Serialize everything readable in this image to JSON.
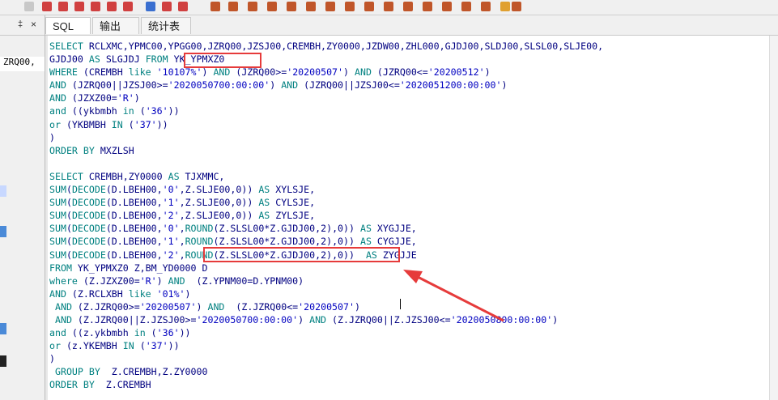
{
  "left_panel": {
    "pin_glyph": "‡",
    "close_glyph": "×",
    "entry_text": "ZRQ00,"
  },
  "tabs": [
    {
      "label": "SQL"
    },
    {
      "label": "输出"
    },
    {
      "label": "统计表"
    }
  ],
  "code_lines": [
    [
      {
        "t": "SELECT",
        "c": "kw"
      },
      {
        "t": " RCLXMC,YPMC00,YPGG00,JZRQ00,JZSJ00,CREMBH,ZY0000,JZDW00,ZHL000,GJDJ00,SLDJ00,SLSL00,SLJE00,"
      }
    ],
    [
      {
        "t": "GJDJ00 "
      },
      {
        "t": "AS",
        "c": "kw"
      },
      {
        "t": " SLGJDJ "
      },
      {
        "t": "FROM",
        "c": "kw"
      },
      {
        "t": " YK_YPMXZ0"
      }
    ],
    [
      {
        "t": "WHERE",
        "c": "kw"
      },
      {
        "t": " (CREMBH "
      },
      {
        "t": "like",
        "c": "kw"
      },
      {
        "t": " "
      },
      {
        "t": "'10107%'",
        "c": "str"
      },
      {
        "t": ") "
      },
      {
        "t": "AND",
        "c": "kw"
      },
      {
        "t": " (JZRQ00>="
      },
      {
        "t": "'20200507'",
        "c": "str"
      },
      {
        "t": ") "
      },
      {
        "t": "AND",
        "c": "kw"
      },
      {
        "t": " (JZRQ00<="
      },
      {
        "t": "'20200512'",
        "c": "str"
      },
      {
        "t": ")"
      }
    ],
    [
      {
        "t": "AND",
        "c": "kw"
      },
      {
        "t": " (JZRQ00||JZSJ00>="
      },
      {
        "t": "'2020050700:00:00'",
        "c": "str"
      },
      {
        "t": ") "
      },
      {
        "t": "AND",
        "c": "kw"
      },
      {
        "t": " (JZRQ00||JZSJ00<="
      },
      {
        "t": "'2020051200:00:00'",
        "c": "str"
      },
      {
        "t": ")"
      }
    ],
    [
      {
        "t": "AND",
        "c": "kw"
      },
      {
        "t": " (JZXZ00="
      },
      {
        "t": "'R'",
        "c": "str"
      },
      {
        "t": ")"
      }
    ],
    [
      {
        "t": "and",
        "c": "kw"
      },
      {
        "t": " ((ykbmbh "
      },
      {
        "t": "in",
        "c": "kw"
      },
      {
        "t": " ("
      },
      {
        "t": "'36'",
        "c": "str"
      },
      {
        "t": "))"
      }
    ],
    [
      {
        "t": "or",
        "c": "kw"
      },
      {
        "t": " (YKBMBH "
      },
      {
        "t": "IN",
        "c": "kw"
      },
      {
        "t": " ("
      },
      {
        "t": "'37'",
        "c": "str"
      },
      {
        "t": "))"
      }
    ],
    [
      {
        "t": ")"
      }
    ],
    [
      {
        "t": "ORDER BY",
        "c": "kw"
      },
      {
        "t": " MXZLSH"
      }
    ],
    [],
    [
      {
        "t": "SELECT",
        "c": "kw"
      },
      {
        "t": " CREMBH,ZY0000 "
      },
      {
        "t": "AS",
        "c": "kw"
      },
      {
        "t": " TJXMMC,"
      }
    ],
    [
      {
        "t": "SUM",
        "c": "kw"
      },
      {
        "t": "("
      },
      {
        "t": "DECODE",
        "c": "kw"
      },
      {
        "t": "(D.LBEH00,"
      },
      {
        "t": "'0'",
        "c": "str"
      },
      {
        "t": ",Z.SLJE00,0)) "
      },
      {
        "t": "AS",
        "c": "kw"
      },
      {
        "t": " XYLSJE,"
      }
    ],
    [
      {
        "t": "SUM",
        "c": "kw"
      },
      {
        "t": "("
      },
      {
        "t": "DECODE",
        "c": "kw"
      },
      {
        "t": "(D.LBEH00,"
      },
      {
        "t": "'1'",
        "c": "str"
      },
      {
        "t": ",Z.SLJE00,0)) "
      },
      {
        "t": "AS",
        "c": "kw"
      },
      {
        "t": " CYLSJE,"
      }
    ],
    [
      {
        "t": "SUM",
        "c": "kw"
      },
      {
        "t": "("
      },
      {
        "t": "DECODE",
        "c": "kw"
      },
      {
        "t": "(D.LBEH00,"
      },
      {
        "t": "'2'",
        "c": "str"
      },
      {
        "t": ",Z.SLJE00,0)) "
      },
      {
        "t": "AS",
        "c": "kw"
      },
      {
        "t": " ZYLSJE,"
      }
    ],
    [
      {
        "t": "SUM",
        "c": "kw"
      },
      {
        "t": "("
      },
      {
        "t": "DECODE",
        "c": "kw"
      },
      {
        "t": "(D.LBEH00,"
      },
      {
        "t": "'0'",
        "c": "str"
      },
      {
        "t": ","
      },
      {
        "t": "ROUND",
        "c": "kw"
      },
      {
        "t": "(Z.SLSL00*Z.GJDJ00,2),0)) "
      },
      {
        "t": "AS",
        "c": "kw"
      },
      {
        "t": " XYGJJE,"
      }
    ],
    [
      {
        "t": "SUM",
        "c": "kw"
      },
      {
        "t": "("
      },
      {
        "t": "DECODE",
        "c": "kw"
      },
      {
        "t": "(D.LBEH00,"
      },
      {
        "t": "'1'",
        "c": "str"
      },
      {
        "t": ","
      },
      {
        "t": "ROUND",
        "c": "kw"
      },
      {
        "t": "(Z.SLSL00*Z.GJDJ00,2),0)) "
      },
      {
        "t": "AS",
        "c": "kw"
      },
      {
        "t": " CYGJJE,"
      }
    ],
    [
      {
        "t": "SUM",
        "c": "kw"
      },
      {
        "t": "("
      },
      {
        "t": "DECODE",
        "c": "kw"
      },
      {
        "t": "(D.LBEH00,"
      },
      {
        "t": "'2'",
        "c": "str"
      },
      {
        "t": ","
      },
      {
        "t": "ROUND",
        "c": "kw"
      },
      {
        "t": "(Z.SLSL00*Z.GJDJ00,2),0))  "
      },
      {
        "t": "AS",
        "c": "kw"
      },
      {
        "t": " ZYGJJE"
      }
    ],
    [
      {
        "t": "FROM",
        "c": "kw"
      },
      {
        "t": " YK_YPMXZ0 Z,BM_YD0000 D"
      }
    ],
    [
      {
        "t": "where",
        "c": "kw"
      },
      {
        "t": " (Z.JZXZ00="
      },
      {
        "t": "'R'",
        "c": "str"
      },
      {
        "t": ") "
      },
      {
        "t": "AND",
        "c": "kw"
      },
      {
        "t": "  (Z.YPNM00=D.YPNM00)"
      }
    ],
    [
      {
        "t": "AND",
        "c": "kw"
      },
      {
        "t": " (Z.RCLXBH "
      },
      {
        "t": "like",
        "c": "kw"
      },
      {
        "t": " "
      },
      {
        "t": "'01%'",
        "c": "str"
      },
      {
        "t": ")"
      }
    ],
    [
      {
        "t": " AND",
        "c": "kw"
      },
      {
        "t": " (Z.JZRQ00>="
      },
      {
        "t": "'20200507'",
        "c": "str"
      },
      {
        "t": ") "
      },
      {
        "t": "AND",
        "c": "kw"
      },
      {
        "t": "  (Z.JZRQ00<="
      },
      {
        "t": "'20200507'",
        "c": "str"
      },
      {
        "t": ")"
      }
    ],
    [
      {
        "t": " AND",
        "c": "kw"
      },
      {
        "t": " (Z.JZRQ00||Z.JZSJ00>="
      },
      {
        "t": "'2020050700:00:00'",
        "c": "str"
      },
      {
        "t": ") "
      },
      {
        "t": "AND",
        "c": "kw"
      },
      {
        "t": " (Z.JZRQ00||Z.JZSJ00<="
      },
      {
        "t": "'2020050800:00:00'",
        "c": "str"
      },
      {
        "t": ")"
      }
    ],
    [
      {
        "t": "and",
        "c": "kw"
      },
      {
        "t": " ((z.ykbmbh "
      },
      {
        "t": "in",
        "c": "kw"
      },
      {
        "t": " ("
      },
      {
        "t": "'36'",
        "c": "str"
      },
      {
        "t": "))"
      }
    ],
    [
      {
        "t": "or",
        "c": "kw"
      },
      {
        "t": " (z.YKEMBH "
      },
      {
        "t": "IN",
        "c": "kw"
      },
      {
        "t": " ("
      },
      {
        "t": "'37'",
        "c": "str"
      },
      {
        "t": "))"
      }
    ],
    [
      {
        "t": ")"
      }
    ],
    [
      {
        "t": " GROUP BY",
        "c": "kw"
      },
      {
        "t": "  Z.CREMBH,Z.ZY0000"
      }
    ],
    [
      {
        "t": "ORDER BY",
        "c": "kw"
      },
      {
        "t": "  Z.CREMBH"
      }
    ]
  ],
  "colors": {
    "highlight": "#e63b3b",
    "keyword": "#008080",
    "string": "#0000c0",
    "identifier": "#000080"
  }
}
